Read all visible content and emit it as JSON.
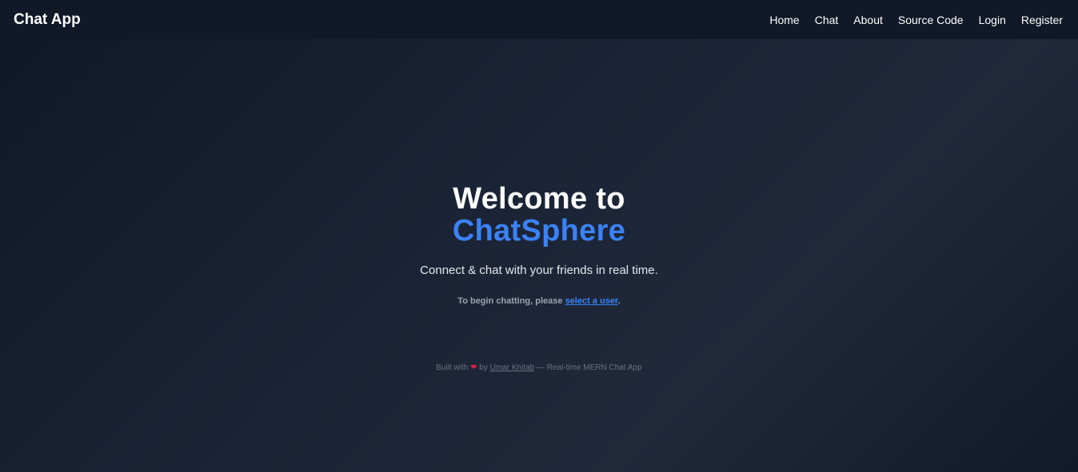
{
  "navbar": {
    "brand": "Chat App",
    "links": [
      "Home",
      "Chat",
      "About",
      "Source Code",
      "Login",
      "Register"
    ]
  },
  "hero": {
    "title_line1": "Welcome to",
    "title_line2": "ChatSphere",
    "tagline": "Connect & chat with your friends in real time.",
    "begin_prefix": "To begin chatting, please ",
    "begin_link": "select a user",
    "begin_suffix": "."
  },
  "footer": {
    "prefix": "Built with ",
    "heart_icon": "heart-icon",
    "by": " by ",
    "author": "Umar Khitab",
    "suffix": " — Real-time MERN Chat App"
  },
  "colors": {
    "accent": "#3b82f6",
    "navbar_bg": "#111827",
    "heart": "#e11d48"
  }
}
